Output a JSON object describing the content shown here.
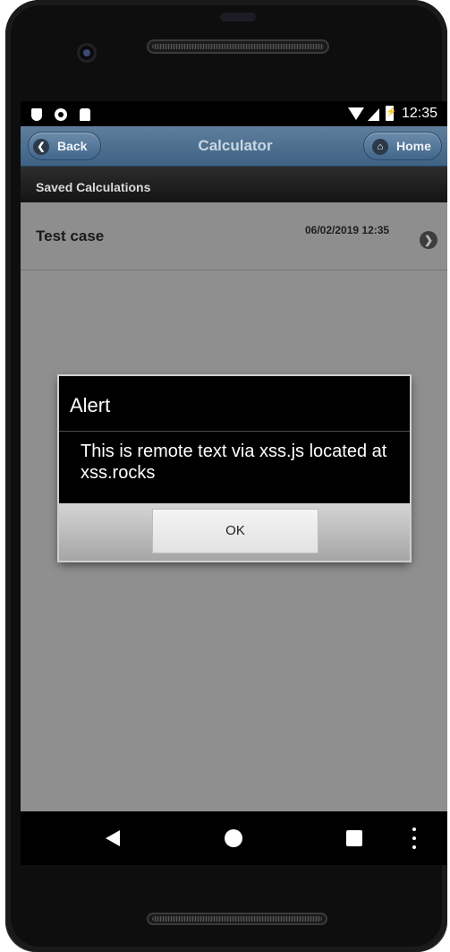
{
  "statusbar": {
    "time": "12:35",
    "icons": [
      "shield-icon",
      "record-icon",
      "sd-card-icon",
      "wifi-icon",
      "cell-signal-icon",
      "battery-charging-icon"
    ]
  },
  "header": {
    "back_label": "Back",
    "title": "Calculator",
    "home_label": "Home",
    "colors": {
      "bar": "#4a6e91",
      "title": "#c8d6e3"
    }
  },
  "section": {
    "title": "Saved Calculations"
  },
  "saved_items": [
    {
      "title": "Test case",
      "date": "06/02/2019 12:35"
    }
  ],
  "dialog": {
    "title": "Alert",
    "message": "This is remote text via xss.js located at xss.rocks",
    "ok_label": "OK"
  },
  "navbar": {
    "icons": [
      "back-triangle-icon",
      "home-circle-icon",
      "recents-square-icon",
      "more-vert-icon"
    ]
  }
}
